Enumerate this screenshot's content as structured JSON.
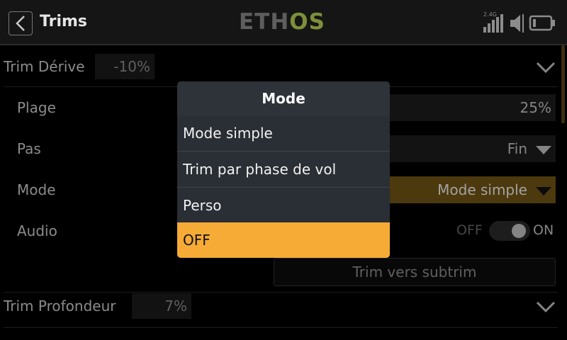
{
  "header": {
    "title": "Trims",
    "logo_eth": "ETH",
    "logo_os": "OS",
    "band_label": "2.4G"
  },
  "rows": {
    "trim_derive": {
      "label": "Trim Dérive",
      "value": "-10%"
    },
    "plage": {
      "label": "Plage",
      "value": "25%"
    },
    "pas": {
      "label": "Pas",
      "value": "Fin"
    },
    "mode": {
      "label": "Mode",
      "value": "Mode simple"
    },
    "audio": {
      "label": "Audio",
      "off_label": "OFF",
      "on_label": "ON",
      "state": "on"
    },
    "subtrim_button": "Trim vers subtrim",
    "trim_profondeur": {
      "label": "Trim Profondeur",
      "value": "7%"
    }
  },
  "popup": {
    "title": "Mode",
    "items": [
      "Mode simple",
      "Trim par phase de vol",
      "Perso",
      "OFF"
    ],
    "selected_index": 3
  },
  "colors": {
    "accent": "#f6ab37",
    "field_orange": "#6e5214",
    "logo_green": "#7d8f3a"
  },
  "icons": [
    "back-arrow-icon",
    "signal-bars-icon",
    "speaker-icon",
    "battery-icon",
    "chevron-down-icon"
  ]
}
